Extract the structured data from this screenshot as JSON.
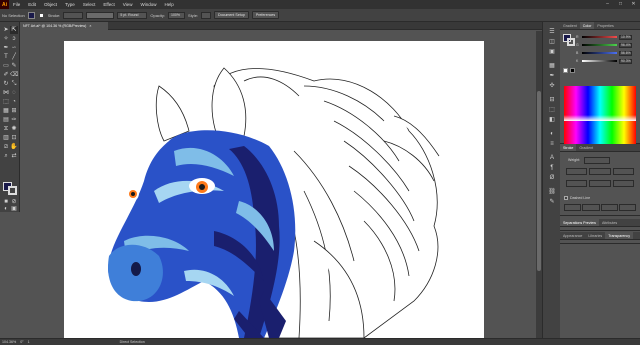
{
  "app": {
    "logo": "Ai"
  },
  "menu": [
    "File",
    "Edit",
    "Object",
    "Type",
    "Select",
    "Effect",
    "View",
    "Window",
    "Help"
  ],
  "window_controls": [
    "–",
    "□",
    "✕"
  ],
  "control_bar": {
    "selection": "No Selection",
    "stroke_label": "Stroke:",
    "brush": "5 pt. Round",
    "opacity_label": "Opacity:",
    "opacity_value": "100%",
    "style_label": "Style:",
    "doc_setup": "Document Setup",
    "preferences": "Preferences"
  },
  "document_tab": {
    "title": "NFT Art.ai* @ 104.36 % (RGB/Preview)",
    "close": "×"
  },
  "right_panel": {
    "tabs": [
      "Gradient",
      "Color",
      "Properties"
    ],
    "channels": [
      {
        "label": "R",
        "value": "10.9%",
        "color": "#f24c4c"
      },
      {
        "label": "G",
        "value": "96.4%",
        "color": "#4cd24c"
      },
      {
        "label": "B",
        "value": "56.6%",
        "color": "#4c70f2"
      },
      {
        "label": "K",
        "value": "90.3%",
        "color": "#cccccc"
      }
    ],
    "stroke_tabs": [
      "Stroke",
      "Gradient"
    ],
    "weight_label": "Weight:",
    "dashed_line": "Dashed Line",
    "separations_tabs": [
      "Separations Preview",
      "Attributes"
    ],
    "appearance_tabs": [
      "Appearance",
      "Libraries",
      "Transparency"
    ]
  },
  "status_bar": {
    "zoom": "104.36%",
    "rotate": "0°",
    "artboard_num": "1",
    "tool": "Direct Selection"
  },
  "colors": {
    "fill": "#1a1a4a",
    "accent": "#2e6fd6",
    "zebra_blue": "#2a52c8",
    "zebra_light": "#7fbde8",
    "zebra_dark": "#1a1f6e"
  }
}
